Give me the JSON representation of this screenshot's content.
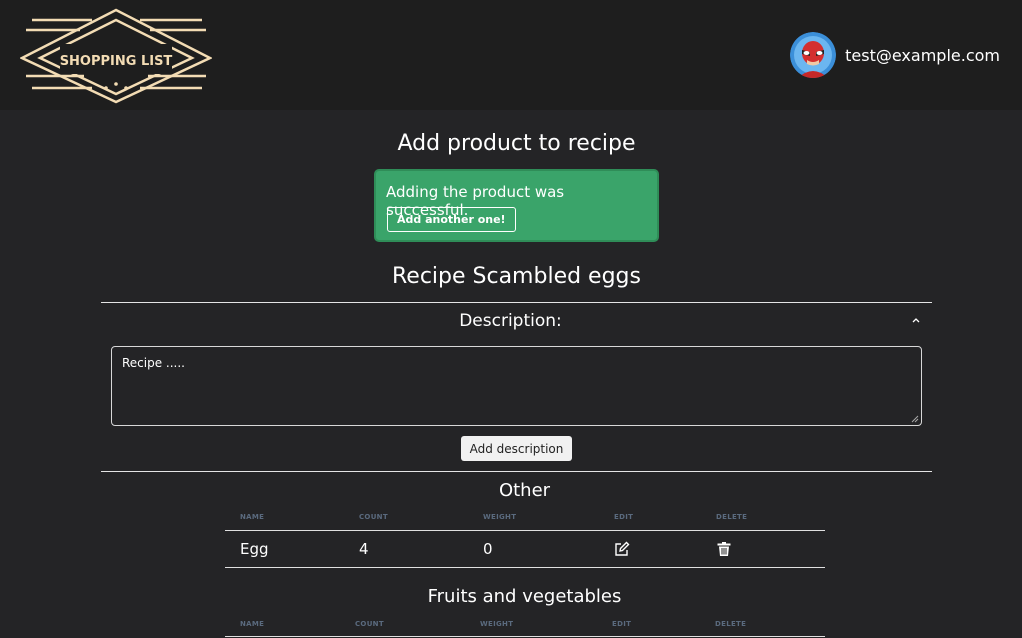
{
  "header": {
    "logo_text": "SHOPPING LIST",
    "user_email": "test@example.com"
  },
  "page": {
    "title": "Add product to recipe"
  },
  "alert": {
    "message": "Adding the product was successful.",
    "button_label": "Add another one!"
  },
  "recipe": {
    "title": "Recipe Scambled eggs",
    "description_heading": "Description:",
    "description_value": "Recipe .....",
    "add_description_label": "Add description"
  },
  "table_headers": {
    "name": "NAME",
    "count": "COUNT",
    "weight": "WEIGHT",
    "edit": "EDIT",
    "delete": "DELETE"
  },
  "sections": [
    {
      "title": "Other",
      "rows": [
        {
          "name": "Egg",
          "count": "4",
          "weight": "0"
        }
      ]
    },
    {
      "title": "Fruits and vegetables",
      "rows": []
    }
  ],
  "icons": {
    "logo": "shopping-list-logo",
    "avatar": "superhero-avatar-icon",
    "collapse": "chevron-up-icon",
    "edit": "edit-icon",
    "delete": "trash-icon"
  },
  "colors": {
    "background": "#242426",
    "header_bg": "#1e1e1e",
    "success": "#3aa46a",
    "logo": "#f3dcb4"
  }
}
